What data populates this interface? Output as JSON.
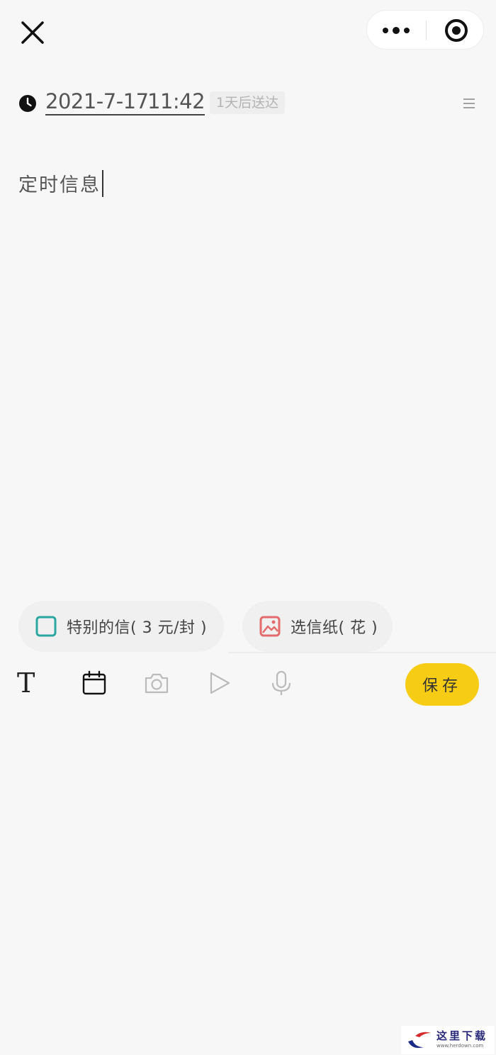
{
  "nav": {
    "close_icon": "close-icon",
    "more_icon": "more-dots-icon",
    "target_icon": "target-icon"
  },
  "schedule": {
    "date": "2021-7-17",
    "time": "11:42",
    "delivery_note": "1天后送达",
    "clock_icon": "clock-icon",
    "menu_icon": "menu-icon"
  },
  "editor": {
    "text": "定时信息"
  },
  "options": {
    "special_letter_label": "特别的信( 3 元/封 )",
    "paper_label": "选信纸( 花 )",
    "accent_teal": "#2aa7a0",
    "accent_red": "#e46b6b"
  },
  "toolbar": {
    "text_tool": "T",
    "calendar_icon": "calendar-icon",
    "camera_icon": "camera-icon",
    "play_icon": "play-icon",
    "mic_icon": "mic-icon",
    "save_label": "保存",
    "save_color": "#f7cc14"
  },
  "watermark": {
    "text": "这里下载",
    "url": "www.herdown.com"
  }
}
